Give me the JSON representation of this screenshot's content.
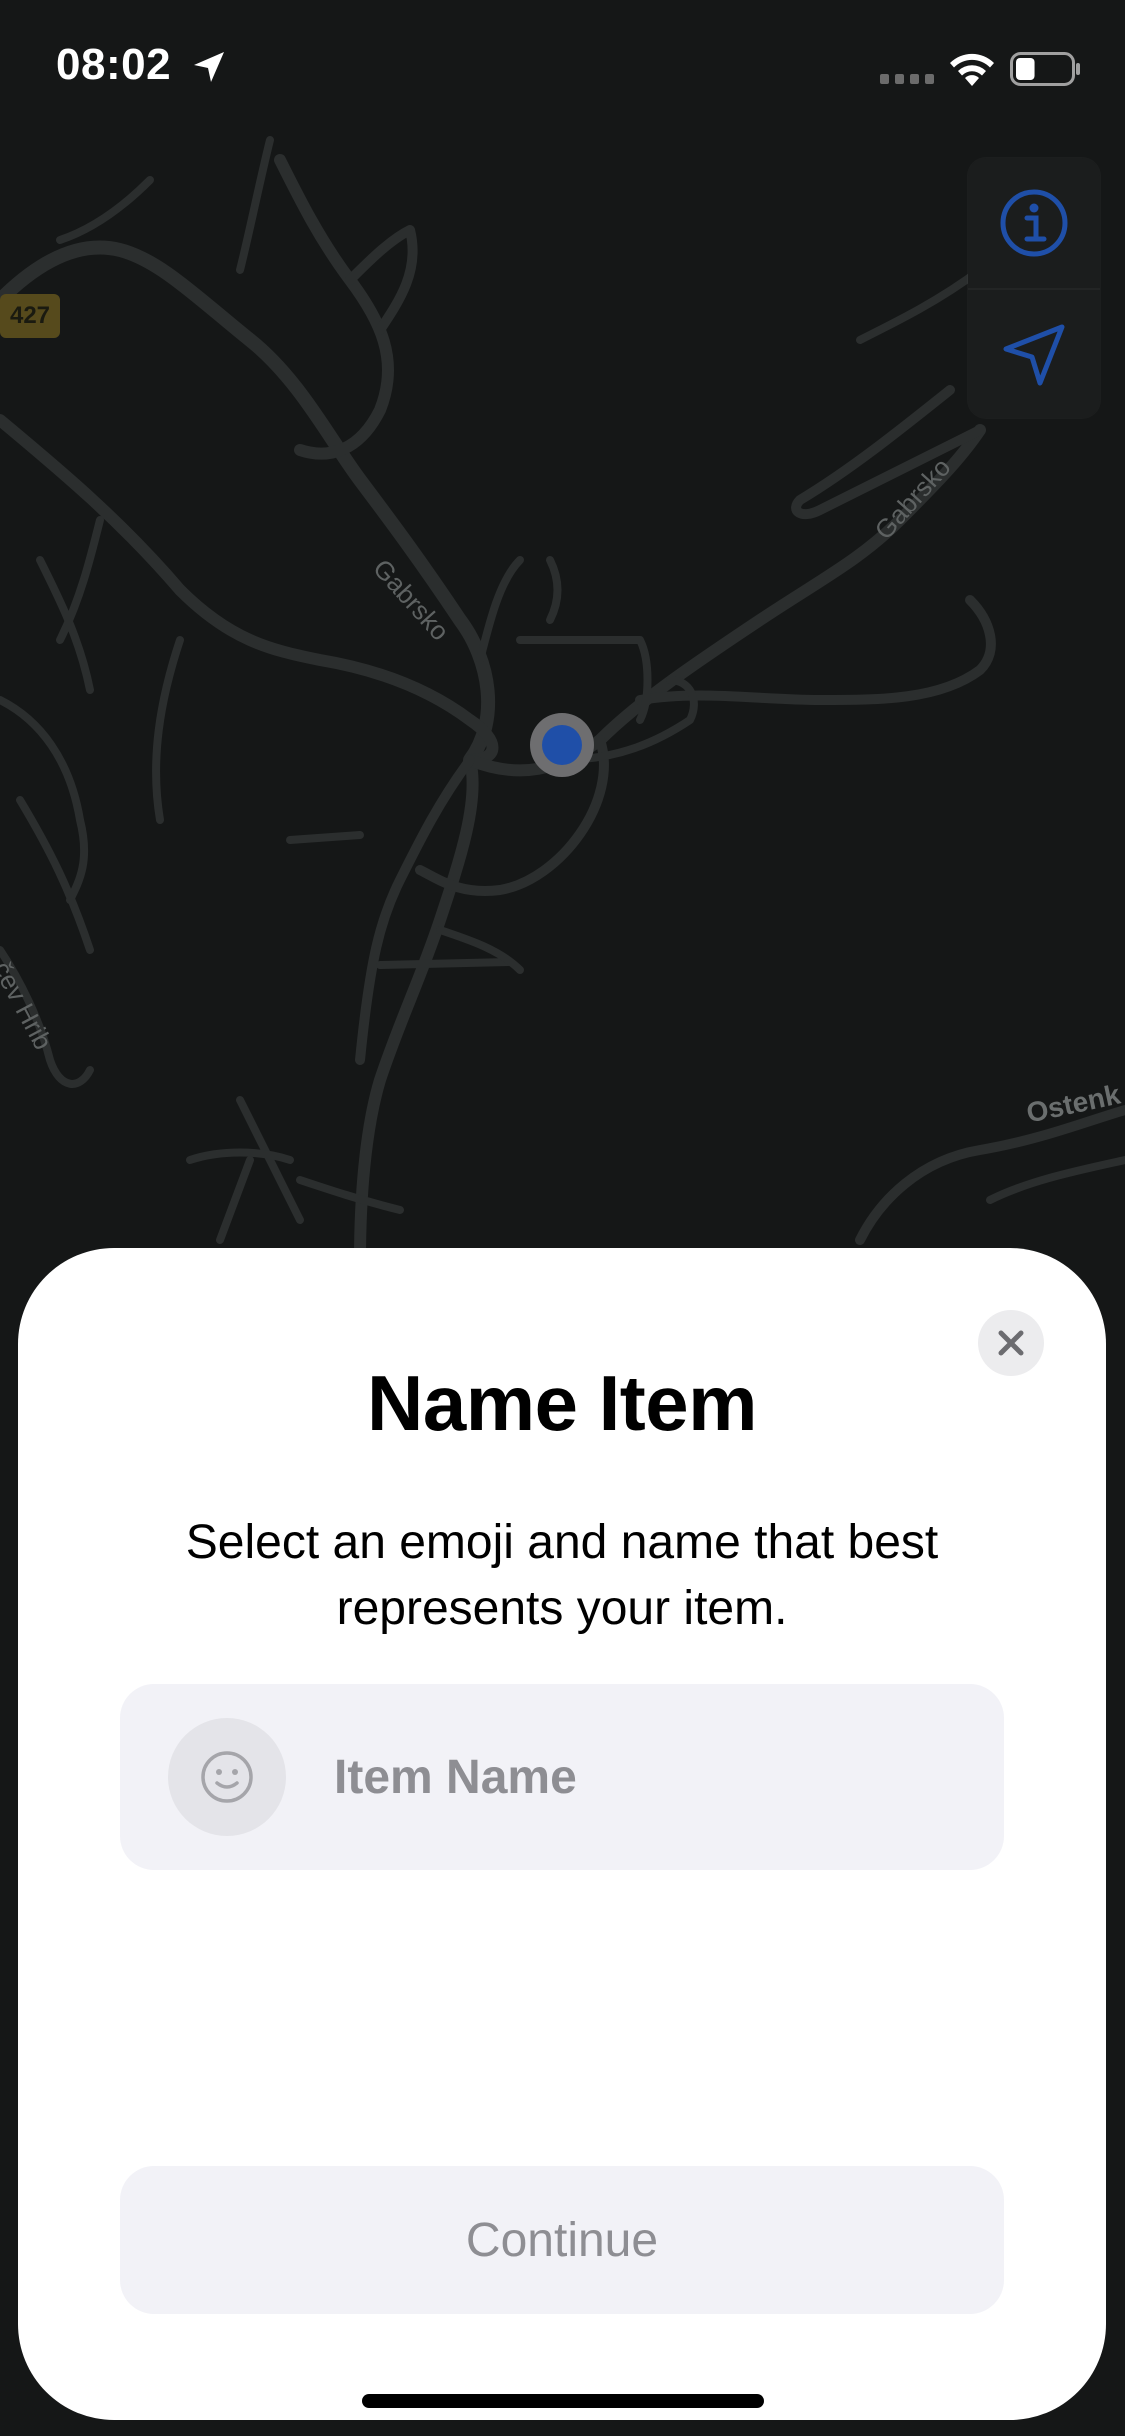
{
  "status_bar": {
    "time": "08:02",
    "location_icon": "location-arrow-icon",
    "signal_icon": "cellular-signal-icon",
    "wifi_icon": "wifi-icon",
    "battery_icon": "battery-icon",
    "battery_level": 0.35
  },
  "map": {
    "road_badge": "427",
    "labels": [
      "Gabrsko",
      "Gabrsko",
      "čev Hrib",
      "Ostenk"
    ],
    "controls": {
      "info_icon": "info-icon",
      "locate_icon": "navigation-arrow-icon"
    },
    "accent_color": "#1f4fa8"
  },
  "sheet": {
    "title": "Name Item",
    "description": "Select an emoji and name that best represents your item.",
    "close_icon": "close-icon",
    "emoji_icon": "smiley-face-icon",
    "item_name_value": "",
    "item_name_placeholder": "Item Name",
    "continue_label": "Continue"
  }
}
